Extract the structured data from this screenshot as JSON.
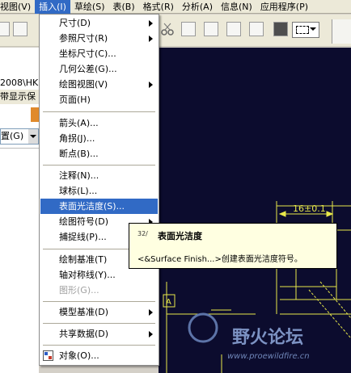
{
  "menubar": {
    "items": [
      {
        "label": "视图(V)"
      },
      {
        "label": "插入(I)",
        "active": true
      },
      {
        "label": "草绘(S)"
      },
      {
        "label": "表(B)"
      },
      {
        "label": "格式(R)"
      },
      {
        "label": "分析(A)"
      },
      {
        "label": "信息(N)"
      },
      {
        "label": "应用程序(P)"
      }
    ]
  },
  "left_panel": {
    "path_text": "2008\\HK",
    "label_text": "带显示保",
    "dropdown_value": "置(G)"
  },
  "insert_menu": {
    "items": [
      {
        "label": "尺寸(D)",
        "submenu": true
      },
      {
        "label": "参照尺寸(R)",
        "submenu": true
      },
      {
        "label": "坐标尺寸(C)..."
      },
      {
        "label": "几何公差(G)..."
      },
      {
        "label": "绘图视图(V)",
        "submenu": true
      },
      {
        "label": "页面(H)"
      },
      {
        "label": "箭头(A)..."
      },
      {
        "label": "角拐(J)..."
      },
      {
        "label": "断点(B)..."
      },
      {
        "label": "注释(N)..."
      },
      {
        "label": "球标(L)..."
      },
      {
        "label": "表面光洁度(S)...",
        "highlighted": true
      },
      {
        "label": "绘图符号(D)",
        "submenu": true
      },
      {
        "label": "捕捉线(P)..."
      },
      {
        "label": "绘制基准(T)",
        "submenu": true
      },
      {
        "label": "轴对称线(Y)..."
      },
      {
        "label": "图形(G)...",
        "disabled": true
      },
      {
        "label": "模型基准(D)",
        "submenu": true
      },
      {
        "label": "共享数据(D)",
        "submenu": true
      },
      {
        "label": "对象(O)..."
      }
    ]
  },
  "tooltip": {
    "icon_text": "32/",
    "title": "表面光洁度",
    "description": "<&Surface Finish...>创建表面光洁度符号。"
  },
  "drawing": {
    "dimension_text": "16±0.1",
    "datum_label": "A"
  },
  "watermark": {
    "text": "野火论坛",
    "url": "www.proewildfire.cn"
  },
  "colors": {
    "menu_highlight": "#316ac5",
    "canvas_bg": "#0c0c2e",
    "drawing_line": "#e8e84a",
    "tooltip_bg": "#ffffe1"
  }
}
